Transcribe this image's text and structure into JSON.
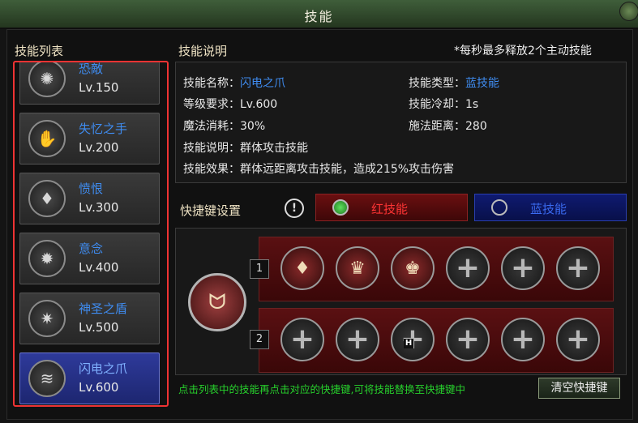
{
  "window": {
    "title": "技能"
  },
  "skill_list": {
    "heading": "技能列表",
    "items": [
      {
        "name": "恐敵",
        "level": "Lv.150",
        "icon": "sun-burst-icon"
      },
      {
        "name": "失忆之手",
        "level": "Lv.200",
        "icon": "winged-hand-icon"
      },
      {
        "name": "愤恨",
        "level": "Lv.300",
        "icon": "crystal-flame-icon"
      },
      {
        "name": "意念",
        "level": "Lv.400",
        "icon": "mind-orb-icon"
      },
      {
        "name": "神圣之盾",
        "level": "Lv.500",
        "icon": "holy-star-icon"
      },
      {
        "name": "闪电之爪",
        "level": "Lv.600",
        "icon": "lightning-claw-icon",
        "selected": true
      }
    ]
  },
  "detail": {
    "heading": "技能说明",
    "note": "*每秒最多释放2个主动技能",
    "name_label": "技能名称：",
    "name_value": "闪电之爪",
    "type_label": "技能类型：",
    "type_value": "蓝技能",
    "req_label": "等级要求：",
    "req_value": "Lv.600",
    "cooldown_label": "技能冷却：",
    "cooldown_value": "1s",
    "mp_label": "魔法消耗：",
    "mp_value": "30%",
    "range_label": "施法距离：",
    "range_value": "280",
    "desc_label": "技能说明：",
    "desc_value": "群体攻击技能",
    "effect_label": "技能效果：",
    "effect_value": "群体远距离攻击技能，造成215%攻击伤害"
  },
  "shortcut": {
    "heading": "快捷键设置",
    "warn_glyph": "!",
    "tab_red": "红技能",
    "tab_blue": "蓝技能",
    "active_tab": "red",
    "row1_label": "1",
    "row2_label": "2",
    "row1_slots": [
      "crystal-flame-icon",
      "winged-hand-icon",
      "claw-icon",
      "empty",
      "empty",
      "empty"
    ],
    "row2_slots": [
      "empty",
      "empty",
      "empty",
      "empty",
      "empty",
      "empty"
    ],
    "hint": "点击列表中的技能再点击对应的快捷键,可将技能替换至快捷键中",
    "clear_button": "清空快捷键",
    "cursor_glyph": "H"
  },
  "colors": {
    "accent_blue": "#3f8cf0",
    "hint_green": "#27d02c",
    "red_tab": "#ff3434",
    "list_border": "#e33333"
  }
}
